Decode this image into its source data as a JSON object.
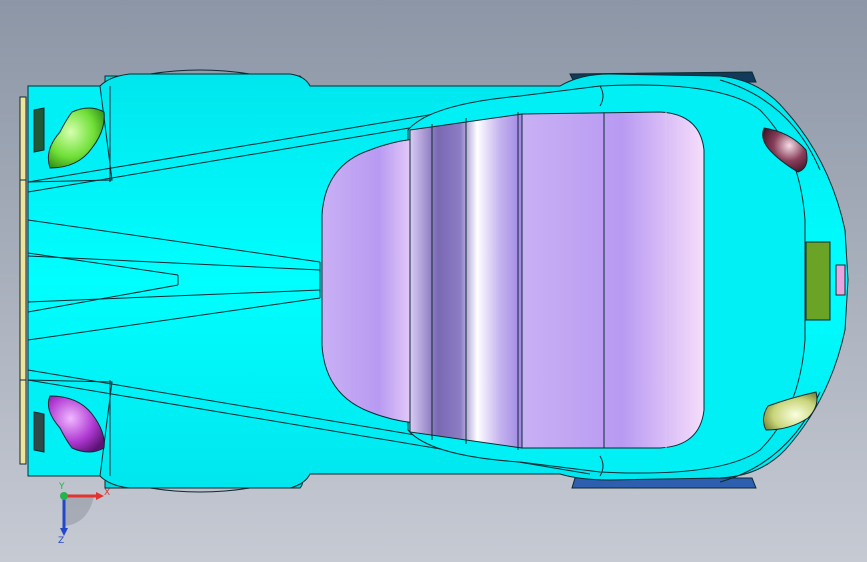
{
  "viewport": {
    "background_top": "#8c96a6",
    "background_bottom": "#c6cad3"
  },
  "model": {
    "body_color": "#00ffff",
    "body_shadow": "#00d2d8",
    "edge_color": "#0b2a33",
    "canopy_color": "#c6a3f5",
    "canopy_light": "#f4ddfb",
    "canopy_dark": "#7a68b3",
    "rear_panel_color": "#f0e39a",
    "intake_front_left": "#6fe037",
    "intake_front_right": "#b03ad3",
    "headlight_top": "#7a3a52",
    "headlight_bottom": "#c8d57a",
    "fuel_cap": "#6aa326",
    "tab_color": "#e9a5e0",
    "wheel_color": "#123a5a",
    "wheel_tint": "#2d5fae"
  },
  "triad": {
    "x_label": "X",
    "y_label": "Y",
    "z_label": "Z",
    "x_color": "#e2332e",
    "y_color": "#25b34a",
    "z_color": "#2446c8"
  }
}
